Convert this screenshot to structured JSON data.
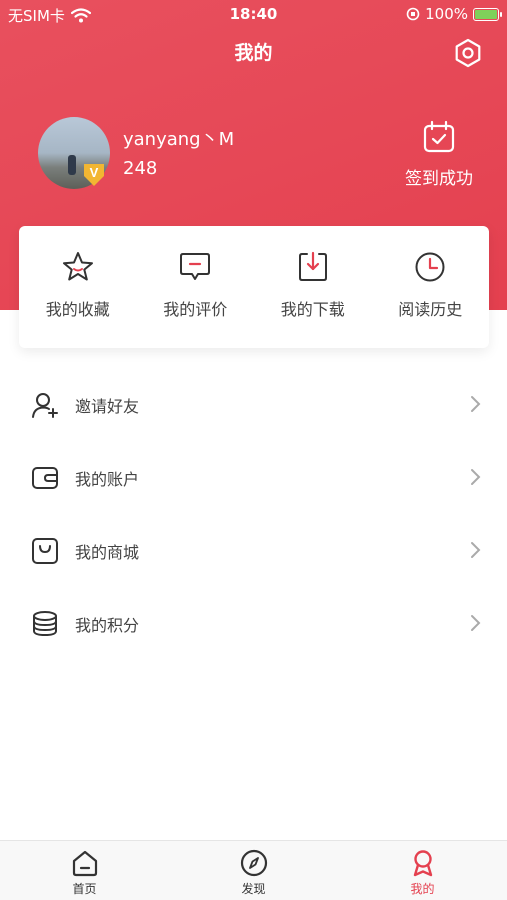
{
  "status": {
    "carrier": "无SIM卡",
    "time": "18:40",
    "battery": "100%"
  },
  "header": {
    "title": "我的"
  },
  "profile": {
    "username": "yanyang丶M",
    "points": "248",
    "badge": "V",
    "signin_label": "签到成功"
  },
  "quick_actions": [
    {
      "label": "我的收藏",
      "icon": "star-icon"
    },
    {
      "label": "我的评价",
      "icon": "comment-icon"
    },
    {
      "label": "我的下载",
      "icon": "download-icon"
    },
    {
      "label": "阅读历史",
      "icon": "clock-icon"
    }
  ],
  "menu": [
    {
      "label": "邀请好友",
      "icon": "add-user-icon"
    },
    {
      "label": "我的账户",
      "icon": "wallet-icon"
    },
    {
      "label": "我的商城",
      "icon": "shopping-bag-icon"
    },
    {
      "label": "我的积分",
      "icon": "coins-icon"
    }
  ],
  "tabs": [
    {
      "label": "首页",
      "icon": "home-icon",
      "active": false
    },
    {
      "label": "发现",
      "icon": "compass-icon",
      "active": false
    },
    {
      "label": "我的",
      "icon": "profile-icon",
      "active": true
    }
  ],
  "colors": {
    "accent": "#e4404f",
    "header_bg": "#e8505e",
    "battery": "#7fd15a",
    "badge": "#f2b632"
  }
}
